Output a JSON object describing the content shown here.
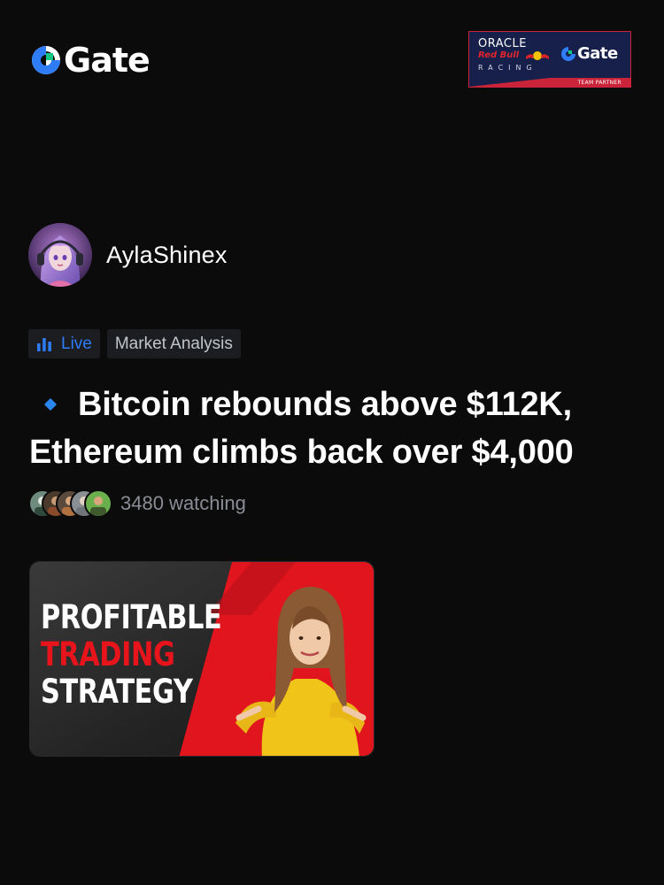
{
  "header": {
    "brand_name": "Gate",
    "partner": {
      "oracle": "ORACLE",
      "red_bull": "Red Bull",
      "racing": "RACING",
      "gate": "Gate",
      "tag": "TEAM PARTNER"
    }
  },
  "author": {
    "name": "AylaShinex"
  },
  "tags": {
    "live": "Live",
    "category": "Market Analysis"
  },
  "headline": {
    "line1": "Bitcoin rebounds above $112K,",
    "line2": "Ethereum climbs back over $4,000"
  },
  "watchers": {
    "count_text": "3480 watching"
  },
  "thumbnail": {
    "line1": "PROFITABLE",
    "line2": "TRADING",
    "line3": "STRATEGY"
  },
  "colors": {
    "background": "#0b0b0b",
    "accent_blue": "#2e7cf6",
    "brand_red": "#e8141c"
  }
}
